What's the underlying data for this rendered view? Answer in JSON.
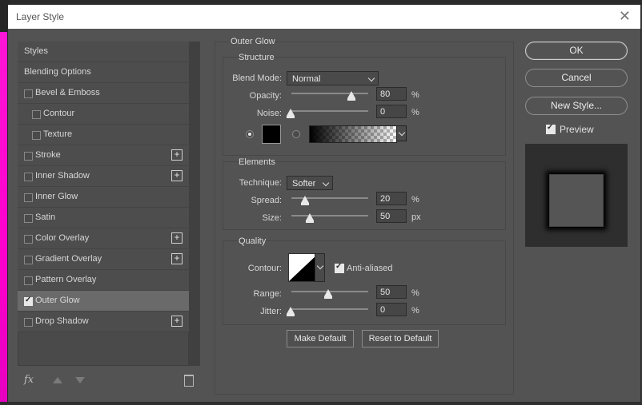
{
  "window": {
    "title": "Layer Style",
    "close_glyph": "✕"
  },
  "styles": {
    "items": [
      {
        "label": "Styles",
        "checkbox": false,
        "indent": false,
        "checked": false,
        "plus": false,
        "selected": false
      },
      {
        "label": "Blending Options",
        "checkbox": false,
        "indent": false,
        "checked": false,
        "plus": false,
        "selected": false
      },
      {
        "label": "Bevel & Emboss",
        "checkbox": true,
        "indent": false,
        "checked": false,
        "plus": false,
        "selected": false
      },
      {
        "label": "Contour",
        "checkbox": true,
        "indent": true,
        "checked": false,
        "plus": false,
        "selected": false
      },
      {
        "label": "Texture",
        "checkbox": true,
        "indent": true,
        "checked": false,
        "plus": false,
        "selected": false
      },
      {
        "label": "Stroke",
        "checkbox": true,
        "indent": false,
        "checked": false,
        "plus": true,
        "selected": false
      },
      {
        "label": "Inner Shadow",
        "checkbox": true,
        "indent": false,
        "checked": false,
        "plus": true,
        "selected": false
      },
      {
        "label": "Inner Glow",
        "checkbox": true,
        "indent": false,
        "checked": false,
        "plus": false,
        "selected": false
      },
      {
        "label": "Satin",
        "checkbox": true,
        "indent": false,
        "checked": false,
        "plus": false,
        "selected": false
      },
      {
        "label": "Color Overlay",
        "checkbox": true,
        "indent": false,
        "checked": false,
        "plus": true,
        "selected": false
      },
      {
        "label": "Gradient Overlay",
        "checkbox": true,
        "indent": false,
        "checked": false,
        "plus": true,
        "selected": false
      },
      {
        "label": "Pattern Overlay",
        "checkbox": true,
        "indent": false,
        "checked": false,
        "plus": false,
        "selected": false
      },
      {
        "label": "Outer Glow",
        "checkbox": true,
        "indent": false,
        "checked": true,
        "plus": false,
        "selected": true
      },
      {
        "label": "Drop Shadow",
        "checkbox": true,
        "indent": false,
        "checked": false,
        "plus": true,
        "selected": false
      }
    ],
    "footer": {
      "fx_label": "fx"
    }
  },
  "outer_glow": {
    "title": "Outer Glow",
    "structure": {
      "title": "Structure",
      "blend_mode_label": "Blend Mode:",
      "blend_mode_value": "Normal",
      "opacity_label": "Opacity:",
      "opacity_value": "80",
      "opacity_unit": "%",
      "noise_label": "Noise:",
      "noise_value": "0",
      "noise_unit": "%",
      "glow_color": "#000000"
    },
    "elements": {
      "title": "Elements",
      "technique_label": "Technique:",
      "technique_value": "Softer",
      "spread_label": "Spread:",
      "spread_value": "20",
      "spread_unit": "%",
      "size_label": "Size:",
      "size_value": "50",
      "size_unit": "px"
    },
    "quality": {
      "title": "Quality",
      "contour_label": "Contour:",
      "anti_aliased_label": "Anti-aliased",
      "anti_aliased_checked": true,
      "range_label": "Range:",
      "range_value": "50",
      "range_unit": "%",
      "jitter_label": "Jitter:",
      "jitter_value": "0",
      "jitter_unit": "%"
    },
    "make_default_label": "Make Default",
    "reset_default_label": "Reset to Default"
  },
  "actions": {
    "ok_label": "OK",
    "cancel_label": "Cancel",
    "new_style_label": "New Style...",
    "preview_label": "Preview",
    "preview_checked": true
  }
}
